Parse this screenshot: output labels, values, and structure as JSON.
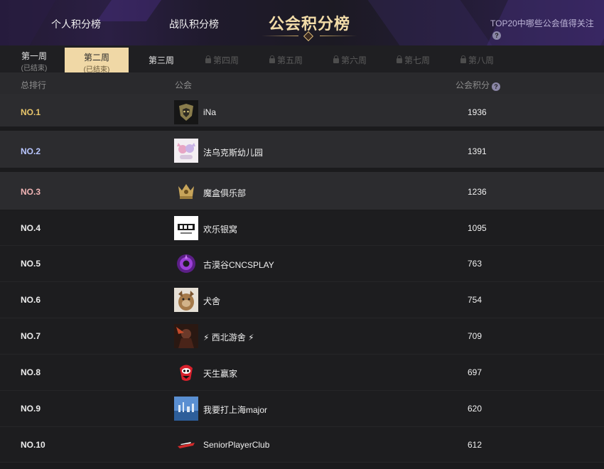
{
  "header": {
    "nav_personal": "个人积分榜",
    "nav_team": "战队积分榜",
    "title": "公会积分榜",
    "rule_link": "TOP20中哪些公会值得关注",
    "help_icon": "question-circle-icon"
  },
  "tabs": [
    {
      "label": "第一周",
      "sub": "(已结束)",
      "state": "done"
    },
    {
      "label": "第二周",
      "sub": "(已结束)",
      "state": "active"
    },
    {
      "label": "第三周",
      "sub": "",
      "state": "normal"
    },
    {
      "label": "第四周",
      "state": "locked"
    },
    {
      "label": "第五周",
      "state": "locked"
    },
    {
      "label": "第六周",
      "state": "locked"
    },
    {
      "label": "第七周",
      "state": "locked"
    },
    {
      "label": "第八周",
      "state": "locked"
    }
  ],
  "table": {
    "col_rank": "总排行",
    "col_guild": "公会",
    "col_points": "公会积分",
    "rows": [
      {
        "rank": "NO.1",
        "name": "iNa",
        "points": "1936"
      },
      {
        "rank": "NO.2",
        "name": "法乌克斯幼儿园",
        "points": "1391"
      },
      {
        "rank": "NO.3",
        "name": "魔盒俱乐部",
        "points": "1236"
      },
      {
        "rank": "NO.4",
        "name": "欢乐银窝",
        "points": "1095"
      },
      {
        "rank": "NO.5",
        "name": "古漠谷CNCSPLAY",
        "points": "763"
      },
      {
        "rank": "NO.6",
        "name": "犬舍",
        "points": "754"
      },
      {
        "rank": "NO.7",
        "name": "⚡ 西北游舍 ⚡",
        "points": "709"
      },
      {
        "rank": "NO.8",
        "name": "天生赢家",
        "points": "697"
      },
      {
        "rank": "NO.9",
        "name": "我要打上海major",
        "points": "620"
      },
      {
        "rank": "NO.10",
        "name": "SeniorPlayerClub",
        "points": "612"
      }
    ]
  },
  "colors": {
    "accent_gold": "#f0d8a6",
    "rank1": "#e8c56a",
    "rank2": "#b8c6ff",
    "rank3": "#f0b4b4"
  }
}
